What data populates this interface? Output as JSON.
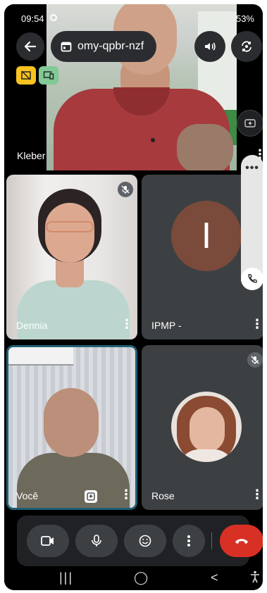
{
  "status_bar": {
    "time": "09:54",
    "battery": "53%"
  },
  "header": {
    "meeting_code": "omy-qpbr-nzf"
  },
  "participants": {
    "main": {
      "name": "Kleber"
    },
    "tiles": [
      {
        "name": "Dennia"
      },
      {
        "name": "IPMP -",
        "initial": "I"
      },
      {
        "name": "Você"
      },
      {
        "name": "Rose"
      }
    ]
  },
  "side_panel": {
    "dots": "•••"
  },
  "nav_bar": {
    "recents": "|||",
    "home": "◯",
    "back": "<"
  },
  "colors": {
    "end_call": "#d93025",
    "self_border": "#1f5f73",
    "ipmp_avatar": "#7a4a3a"
  }
}
